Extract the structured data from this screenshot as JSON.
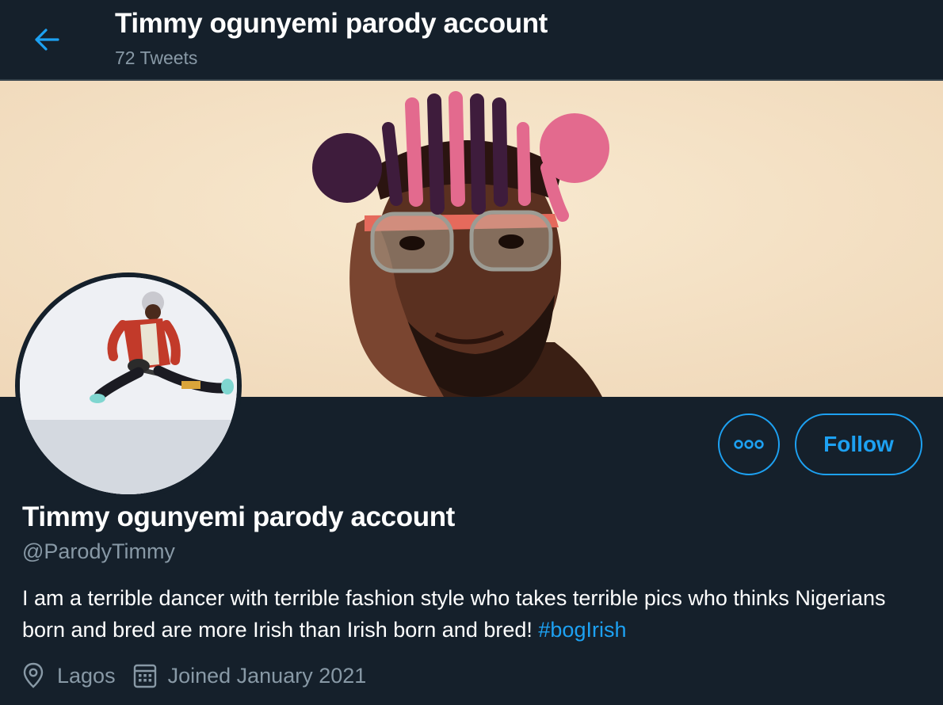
{
  "header": {
    "title": "Timmy ogunyemi parody account",
    "tweet_count": "72 Tweets",
    "back_icon": "arrow-left-icon"
  },
  "profile": {
    "display_name": "Timmy ogunyemi parody account",
    "handle": "@ParodyTimmy",
    "bio_text": "I am a terrible dancer with terrible fashion style who takes terrible pics who thinks Nigerians born and bred are more Irish than Irish born and bred!",
    "bio_hashtag": "#bogIrish",
    "location": "Lagos",
    "joined": "Joined January 2021"
  },
  "actions": {
    "more_icon": "more-options-icon",
    "follow_label": "Follow"
  },
  "colors": {
    "background": "#15202b",
    "accent": "#1da1f2",
    "secondary_text": "#8899a6",
    "divider": "#38444d"
  }
}
